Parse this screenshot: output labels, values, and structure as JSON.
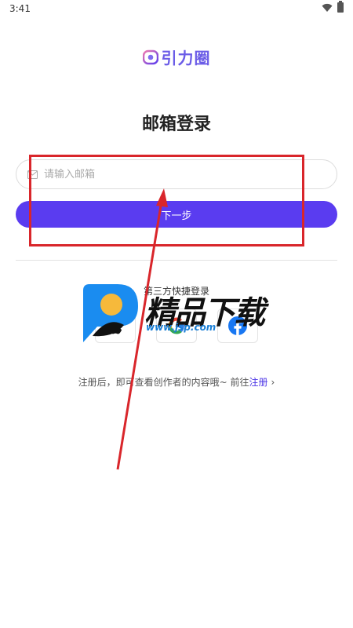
{
  "status_bar": {
    "time": "3:41"
  },
  "app": {
    "name": "引力圈"
  },
  "page": {
    "title": "邮箱登录"
  },
  "form": {
    "email_placeholder": "请输入邮箱",
    "next_label": "下一步"
  },
  "third_party": {
    "title": "第三方快捷登录",
    "providers": [
      {
        "name": "apple-icon"
      },
      {
        "name": "google-icon"
      },
      {
        "name": "facebook-icon"
      }
    ]
  },
  "signup": {
    "prefix": "注册后，即可查看创作者的内容哦~ 前往",
    "link": "注册",
    "chevron": "›"
  },
  "watermark": {
    "text": "精品下载",
    "sub": "www.jsp.com"
  },
  "colors": {
    "brand": "#6b5ce7",
    "button": "#5a3cf0",
    "link": "#4a33e6",
    "annotation": "#d9262b"
  }
}
